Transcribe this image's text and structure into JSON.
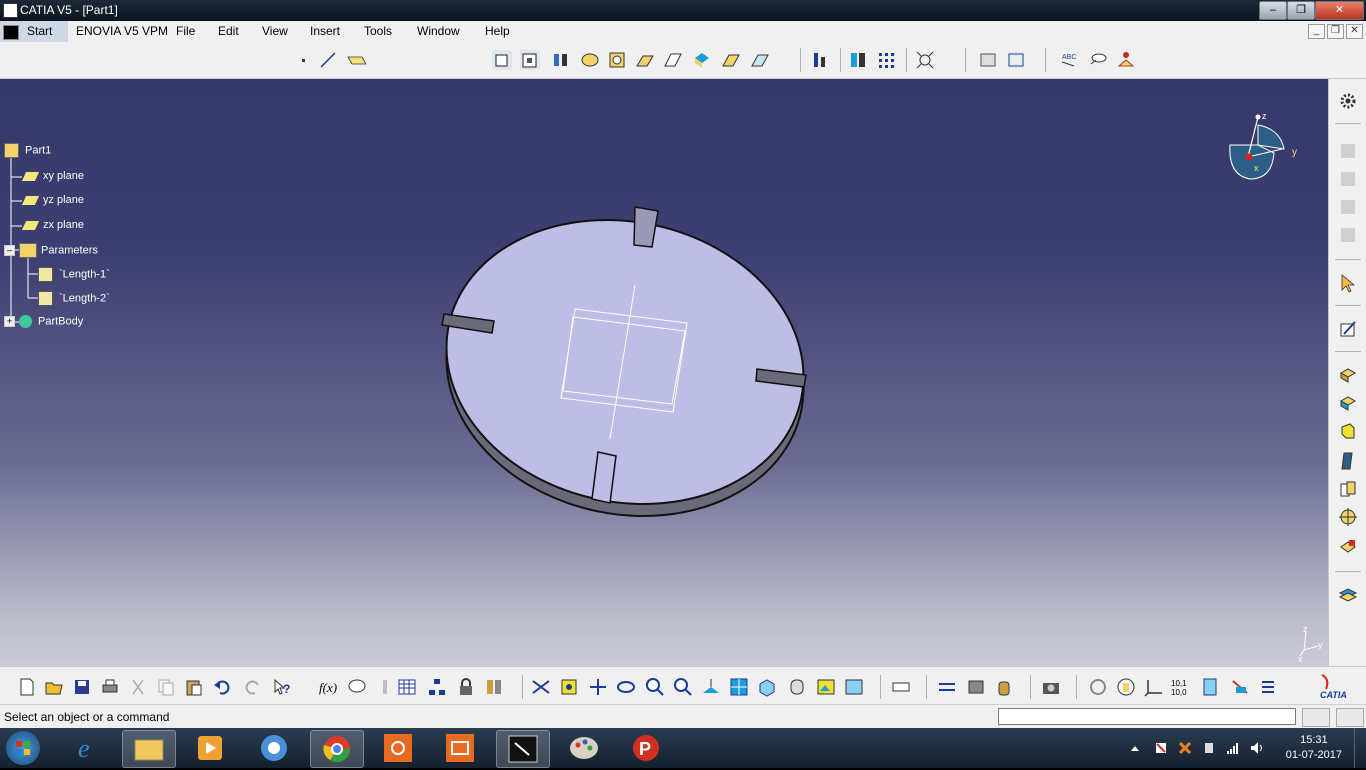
{
  "window": {
    "title": "CATIA V5 - [Part1]",
    "min": "–",
    "max": "❐",
    "close": "✕"
  },
  "menu": {
    "items": [
      "Start",
      "ENOVIA V5 VPM",
      "File",
      "Edit",
      "View",
      "Insert",
      "Tools",
      "Window",
      "Help"
    ],
    "mdi": {
      "min": "_",
      "restore": "❐",
      "close": "✕"
    }
  },
  "tree": {
    "root": "Part1",
    "planes": [
      "xy plane",
      "yz plane",
      "zx plane"
    ],
    "parameters": "Parameters",
    "params": [
      "`Length-1`",
      "`Length-2`"
    ],
    "body": "PartBody"
  },
  "compass": {
    "z": "z",
    "y": "y",
    "x": "x"
  },
  "axis": {
    "z": "z",
    "y": "y",
    "x": "x"
  },
  "brand": {
    "logo_text": "CATIA"
  },
  "status": {
    "message": "Select an object or a command",
    "command_value": ""
  },
  "clock": {
    "time": "15:31",
    "date": "01-07-2017"
  },
  "colors": {
    "viewport_top": "#36386a",
    "viewport_bottom": "#cbcbd7",
    "part_face": "#bdbde6",
    "part_side": "#6a6a7a"
  }
}
